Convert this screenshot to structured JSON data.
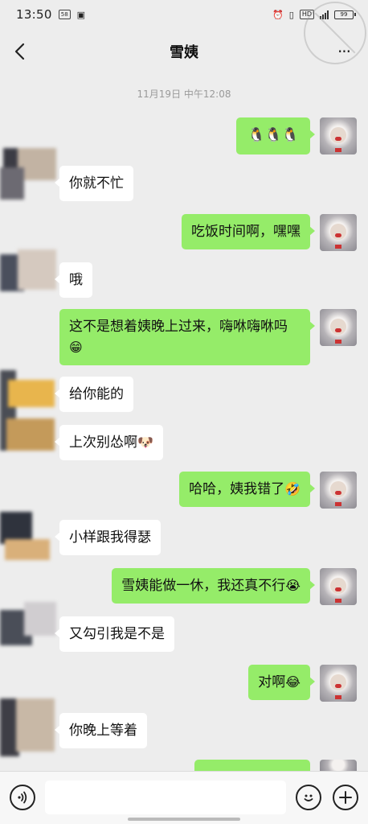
{
  "status_bar": {
    "time": "13:50",
    "badge_1": "58",
    "badge_2": "HD",
    "battery": "99"
  },
  "header": {
    "title": "雪姨"
  },
  "chat": {
    "timestamp": "11月19日 中午12:08",
    "messages": [
      {
        "side": "sent",
        "text": "",
        "emoji": "🐧🐧🐧"
      },
      {
        "side": "recv",
        "text": "你就不忙",
        "emoji": ""
      },
      {
        "side": "sent",
        "text": "吃饭时间啊，嘿嘿",
        "emoji": ""
      },
      {
        "side": "recv",
        "text": "哦",
        "emoji": ""
      },
      {
        "side": "sent",
        "text": "这不是想着姨晚上过来，嗨咻嗨咻吗",
        "emoji": "😁"
      },
      {
        "side": "recv",
        "text": "给你能的",
        "emoji": ""
      },
      {
        "side": "recv",
        "text": "上次别怂啊",
        "emoji": "🐶"
      },
      {
        "side": "sent",
        "text": "哈哈，姨我错了",
        "emoji": "🤣"
      },
      {
        "side": "recv",
        "text": "小样跟我得瑟",
        "emoji": ""
      },
      {
        "side": "sent",
        "text": "雪姨能做一休，我还真不行",
        "emoji": "😭"
      },
      {
        "side": "recv",
        "text": "又勾引我是不是",
        "emoji": ""
      },
      {
        "side": "sent",
        "text": "对啊",
        "emoji": "😂"
      },
      {
        "side": "recv",
        "text": "你晚上等着",
        "emoji": ""
      }
    ]
  },
  "input_bar": {
    "value": "",
    "placeholder": ""
  },
  "colors": {
    "background": "#ededed",
    "sent_bubble": "#95ec69",
    "recv_bubble": "#ffffff"
  },
  "icons": {
    "back": "chevron-left-icon",
    "more": "more-dots-icon",
    "voice": "voice-icon",
    "emoji": "smiley-icon",
    "plus": "plus-icon"
  }
}
